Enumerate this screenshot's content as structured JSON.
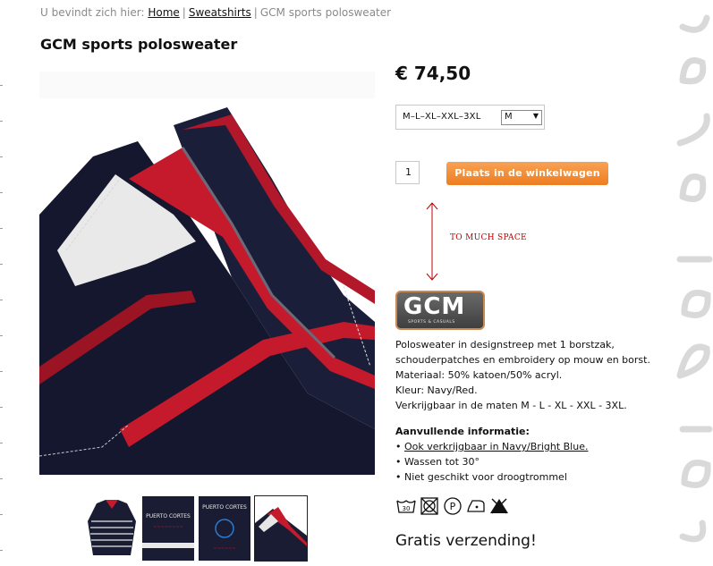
{
  "breadcrumb": {
    "prefix": "U bevindt zich hier:",
    "home": "Home",
    "category": "Sweatshirts",
    "current": "GCM sports polosweater"
  },
  "product": {
    "title": "GCM sports polosweater",
    "price": "€ 74,50",
    "size_options_label": "M–L–XL–XXL–3XL",
    "size_selected": "M",
    "quantity": "1",
    "add_to_cart": "Plaats in de winkelwagen"
  },
  "annotation": {
    "text": "TO MUCH SPACE",
    "color": "#c00000"
  },
  "brand": {
    "name": "GCM",
    "tagline": "SPORTS & CASUALS"
  },
  "description": {
    "line1": "Polosweater in designstreep met 1 borstzak,",
    "line2": "schouderpatches en embroidery op mouw en borst.",
    "line3": "Materiaal: 50% katoen/50% acryl.",
    "line4": "Kleur: Navy/Red.",
    "line5": "Verkrijgbaar in de maten M - L - XL - XXL - 3XL."
  },
  "extra_info": {
    "heading": "Aanvullende informatie:",
    "items": [
      "Ook verkrijgbaar in Navy/Bright Blue.",
      "Wassen tot 30°",
      "Niet geschikt voor droogtrommel"
    ]
  },
  "care_icons": [
    "wash-30-icon",
    "no-tumble-dry-icon",
    "dry-clean-p-icon",
    "iron-low-icon",
    "no-bleach-icon"
  ],
  "thumbnails": [
    {
      "name": "thumb-front",
      "text": ""
    },
    {
      "name": "thumb-embroidery-back",
      "text": "PUERTO CORTES"
    },
    {
      "name": "thumb-embroidery-chest",
      "text": "PUERTO CORTES"
    },
    {
      "name": "thumb-collar-detail",
      "text": ""
    }
  ],
  "shipping": "Gratis verzending!",
  "colors": {
    "accent_orange": "#ed7d20",
    "navy": "#15172e",
    "red": "#c41a2c"
  }
}
